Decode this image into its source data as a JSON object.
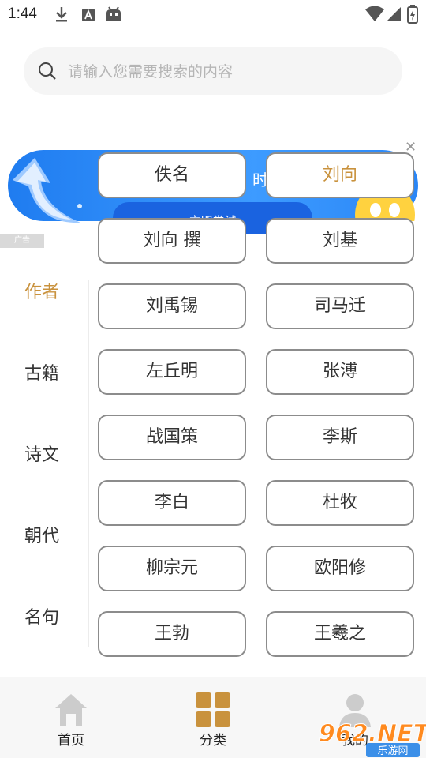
{
  "status_bar": {
    "time": "1:44"
  },
  "search": {
    "placeholder": "请输入您需要搜索的内容"
  },
  "ad": {
    "label": "广告",
    "title_fragment": "时",
    "button_text": "立即尝试"
  },
  "categories": [
    {
      "label": "作者",
      "active": true
    },
    {
      "label": "古籍",
      "active": false
    },
    {
      "label": "诗文",
      "active": false
    },
    {
      "label": "朝代",
      "active": false
    },
    {
      "label": "名句",
      "active": false
    }
  ],
  "tags": [
    {
      "label": "佚名",
      "selected": false
    },
    {
      "label": "刘向",
      "selected": true
    },
    {
      "label": "刘向 撰",
      "selected": false
    },
    {
      "label": "刘基",
      "selected": false
    },
    {
      "label": "刘禹锡",
      "selected": false
    },
    {
      "label": "司马迁",
      "selected": false
    },
    {
      "label": "左丘明",
      "selected": false
    },
    {
      "label": "张溥",
      "selected": false
    },
    {
      "label": "战国策",
      "selected": false
    },
    {
      "label": "李斯",
      "selected": false
    },
    {
      "label": "李白",
      "selected": false
    },
    {
      "label": "杜牧",
      "selected": false
    },
    {
      "label": "柳宗元",
      "selected": false
    },
    {
      "label": "欧阳修",
      "selected": false
    },
    {
      "label": "王勃",
      "selected": false
    },
    {
      "label": "王羲之",
      "selected": false
    }
  ],
  "bottom_nav": [
    {
      "label": "首页",
      "icon": "home-icon",
      "active": false
    },
    {
      "label": "分类",
      "icon": "category-grid-icon",
      "active": true
    },
    {
      "label": "我的",
      "icon": "profile-icon",
      "active": false
    }
  ],
  "watermark": {
    "text": "962.NET",
    "subtext": "乐游网"
  },
  "colors": {
    "accent": "#c9923d",
    "tag_border": "#8c8c8c",
    "nav_bg": "#f7f7f7"
  }
}
